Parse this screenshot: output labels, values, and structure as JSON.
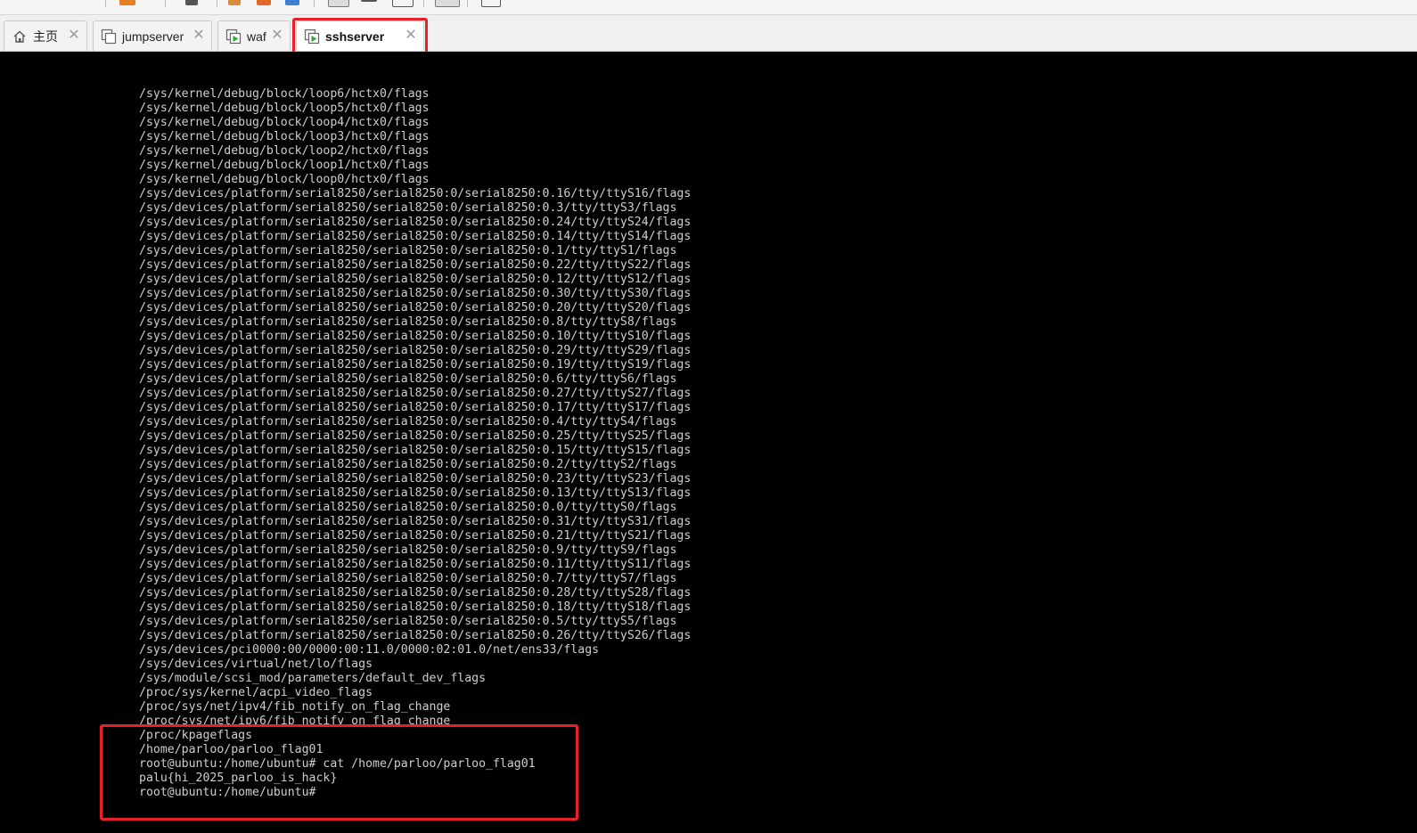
{
  "tabs": [
    {
      "label": "主页",
      "icon": "home-icon",
      "active": false
    },
    {
      "label": "jumpserver",
      "icon": "vm-icon",
      "active": false
    },
    {
      "label": "waf",
      "icon": "vm-running-icon",
      "active": false
    },
    {
      "label": "sshserver",
      "icon": "vm-running-icon",
      "active": true
    }
  ],
  "colors": {
    "highlight": "#e8202a",
    "console_bg": "#000000",
    "console_text": "#cfcfcf",
    "vm_running_green": "#3aa63a"
  },
  "console": {
    "lines": [
      "/sys/kernel/debug/block/loop6/hctx0/flags",
      "/sys/kernel/debug/block/loop5/hctx0/flags",
      "/sys/kernel/debug/block/loop4/hctx0/flags",
      "/sys/kernel/debug/block/loop3/hctx0/flags",
      "/sys/kernel/debug/block/loop2/hctx0/flags",
      "/sys/kernel/debug/block/loop1/hctx0/flags",
      "/sys/kernel/debug/block/loop0/hctx0/flags",
      "/sys/devices/platform/serial8250/serial8250:0/serial8250:0.16/tty/ttyS16/flags",
      "/sys/devices/platform/serial8250/serial8250:0/serial8250:0.3/tty/ttyS3/flags",
      "/sys/devices/platform/serial8250/serial8250:0/serial8250:0.24/tty/ttyS24/flags",
      "/sys/devices/platform/serial8250/serial8250:0/serial8250:0.14/tty/ttyS14/flags",
      "/sys/devices/platform/serial8250/serial8250:0/serial8250:0.1/tty/ttyS1/flags",
      "/sys/devices/platform/serial8250/serial8250:0/serial8250:0.22/tty/ttyS22/flags",
      "/sys/devices/platform/serial8250/serial8250:0/serial8250:0.12/tty/ttyS12/flags",
      "/sys/devices/platform/serial8250/serial8250:0/serial8250:0.30/tty/ttyS30/flags",
      "/sys/devices/platform/serial8250/serial8250:0/serial8250:0.20/tty/ttyS20/flags",
      "/sys/devices/platform/serial8250/serial8250:0/serial8250:0.8/tty/ttyS8/flags",
      "/sys/devices/platform/serial8250/serial8250:0/serial8250:0.10/tty/ttyS10/flags",
      "/sys/devices/platform/serial8250/serial8250:0/serial8250:0.29/tty/ttyS29/flags",
      "/sys/devices/platform/serial8250/serial8250:0/serial8250:0.19/tty/ttyS19/flags",
      "/sys/devices/platform/serial8250/serial8250:0/serial8250:0.6/tty/ttyS6/flags",
      "/sys/devices/platform/serial8250/serial8250:0/serial8250:0.27/tty/ttyS27/flags",
      "/sys/devices/platform/serial8250/serial8250:0/serial8250:0.17/tty/ttyS17/flags",
      "/sys/devices/platform/serial8250/serial8250:0/serial8250:0.4/tty/ttyS4/flags",
      "/sys/devices/platform/serial8250/serial8250:0/serial8250:0.25/tty/ttyS25/flags",
      "/sys/devices/platform/serial8250/serial8250:0/serial8250:0.15/tty/ttyS15/flags",
      "/sys/devices/platform/serial8250/serial8250:0/serial8250:0.2/tty/ttyS2/flags",
      "/sys/devices/platform/serial8250/serial8250:0/serial8250:0.23/tty/ttyS23/flags",
      "/sys/devices/platform/serial8250/serial8250:0/serial8250:0.13/tty/ttyS13/flags",
      "/sys/devices/platform/serial8250/serial8250:0/serial8250:0.0/tty/ttyS0/flags",
      "/sys/devices/platform/serial8250/serial8250:0/serial8250:0.31/tty/ttyS31/flags",
      "/sys/devices/platform/serial8250/serial8250:0/serial8250:0.21/tty/ttyS21/flags",
      "/sys/devices/platform/serial8250/serial8250:0/serial8250:0.9/tty/ttyS9/flags",
      "/sys/devices/platform/serial8250/serial8250:0/serial8250:0.11/tty/ttyS11/flags",
      "/sys/devices/platform/serial8250/serial8250:0/serial8250:0.7/tty/ttyS7/flags",
      "/sys/devices/platform/serial8250/serial8250:0/serial8250:0.28/tty/ttyS28/flags",
      "/sys/devices/platform/serial8250/serial8250:0/serial8250:0.18/tty/ttyS18/flags",
      "/sys/devices/platform/serial8250/serial8250:0/serial8250:0.5/tty/ttyS5/flags",
      "/sys/devices/platform/serial8250/serial8250:0/serial8250:0.26/tty/ttyS26/flags",
      "/sys/devices/pci0000:00/0000:00:11.0/0000:02:01.0/net/ens33/flags",
      "/sys/devices/virtual/net/lo/flags",
      "/sys/module/scsi_mod/parameters/default_dev_flags",
      "/proc/sys/kernel/acpi_video_flags",
      "/proc/sys/net/ipv4/fib_notify_on_flag_change",
      "/proc/sys/net/ipv6/fib_notify_on_flag_change",
      "/proc/kpageflags",
      "/home/parloo/parloo_flag01",
      "root@ubuntu:/home/ubuntu# cat /home/parloo/parloo_flag01",
      "palu{hi_2025_parloo_is_hack}",
      "root@ubuntu:/home/ubuntu#"
    ]
  }
}
